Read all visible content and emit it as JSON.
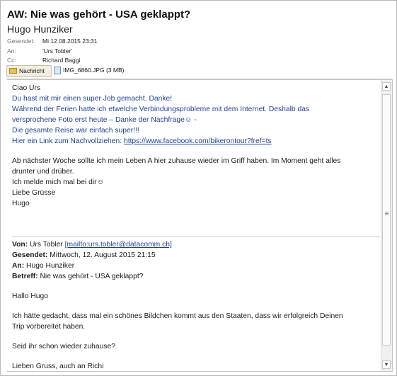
{
  "email": {
    "subject": "AW: Nie was gehört - USA geklappt?",
    "sender": "Hugo Hunziker",
    "sent_label": "Gesendet:",
    "sent_value": "Mi 12.08.2015 23:31",
    "to_label": "An:",
    "to_value": "'Urs Tobler'",
    "cc_label": "Cc:",
    "cc_value": "Richard Baggi"
  },
  "attachments": {
    "message_label": "Nachricht",
    "file_label": "IMG_6860.JPG (3 MB)"
  },
  "body": {
    "reply_lines": [
      "Ciao Urs",
      "Du hast mit mir einen super Job gemacht. Danke!",
      "Während der Ferien hatte ich etwelche Verbindungsprobleme mit dem Internet. Deshalb das",
      "versprochene Foto erst heute – Danke der Nachfrage☺ -",
      "Die gesamte Reise war einfach super!!!"
    ],
    "link_prefix": "Hier ein Link zum Nachvollziehen: ",
    "link_url": "https://www.facebook.com/bikerontour?fref=ts",
    "paragraph2_lines": [
      "Ab nächster Woche sollte ich mein Leben A hier zuhause wieder im Griff haben. Im Moment geht alles",
      "drunter und drüber."
    ],
    "closing_lines": [
      "Ich melde mich mal bei dir☺",
      "Liebe Grüsse",
      "Hugo"
    ]
  },
  "quoted": {
    "from_label": "Von:",
    "from_name": "Urs Tobler ",
    "from_mailto": "[mailto:urs.tobler@datacomm.ch]",
    "sent_label": "Gesendet:",
    "sent_value": "Mittwoch, 12. August 2015 21:15",
    "to_label": "An:",
    "to_value": "Hugo Hunziker",
    "subject_label": "Betreff:",
    "subject_value": "Nie was gehört - USA geklappt?",
    "greeting": "Hallo Hugo",
    "para_lines": [
      "Ich hätte gedacht, dass mal ein schönes Bildchen kommt aus den Staaten, dass wir erfolgreich Deinen",
      "Trip vorbereitet haben."
    ],
    "question": "Seid ihr schon wieder zuhause?",
    "signoff": "Lieben Gruss, auch an Richi"
  }
}
